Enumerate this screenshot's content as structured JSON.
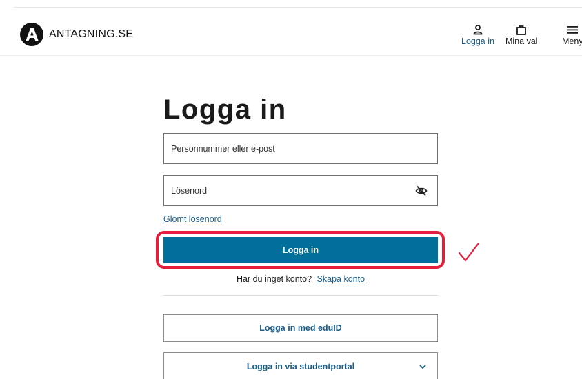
{
  "brand": {
    "logo_letter": "A",
    "name": "ANTAGNING.SE"
  },
  "nav": {
    "login": {
      "label": "Logga in",
      "icon": "user-icon"
    },
    "choices": {
      "label": "Mina val",
      "icon": "bag-icon"
    },
    "menu": {
      "label": "Meny",
      "icon": "hamburger-icon"
    }
  },
  "login_form": {
    "title": "Logga in",
    "username_placeholder": "Personnummer eller e-post",
    "password_placeholder": "Lösenord",
    "show_password_icon": "eye-slash-icon",
    "forgot_password": "Glömt lösenord",
    "submit_label": "Logga in",
    "no_account_text": "Har du inget konto?",
    "create_account_link": "Skapa konto"
  },
  "alternatives": {
    "eduid_label": "Logga in med eduID",
    "studentportal_label": "Logga in via studentportal"
  },
  "colors": {
    "primary": "#00709b",
    "link": "#1a5f8c",
    "highlight": "#e41e3b"
  }
}
